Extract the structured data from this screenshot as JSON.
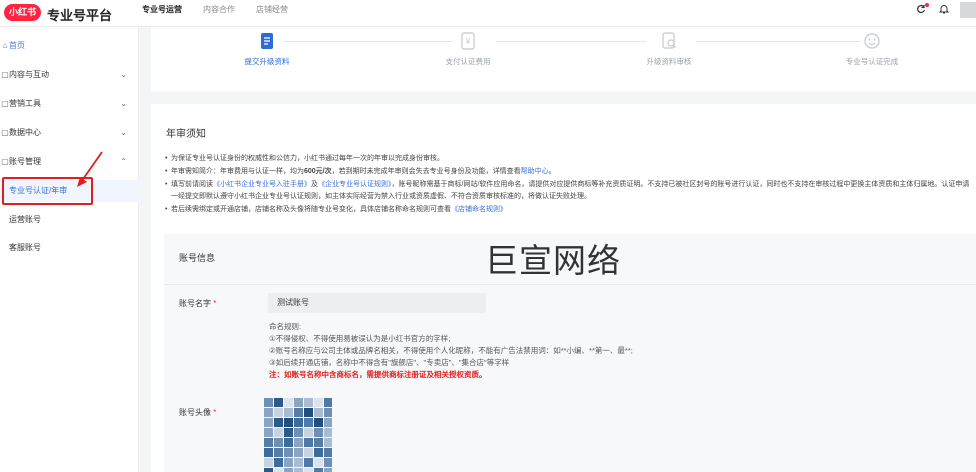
{
  "brand": {
    "logo_text": "小红书",
    "platform": "专业号平台"
  },
  "topnav": [
    {
      "label": "专业号运营"
    },
    {
      "label": "内容合作"
    },
    {
      "label": "店铺经营"
    }
  ],
  "sidebar": {
    "items": [
      {
        "label": "首页",
        "icon": "home-icon"
      },
      {
        "label": "内容与互动",
        "icon": "content-icon"
      },
      {
        "label": "营销工具",
        "icon": "marketing-icon"
      },
      {
        "label": "数据中心",
        "icon": "data-icon"
      },
      {
        "label": "账号管理",
        "icon": "account-icon"
      }
    ],
    "sub_items": [
      {
        "label": "专业号认证/年审"
      },
      {
        "label": "运营账号"
      },
      {
        "label": "客服账号"
      }
    ]
  },
  "steps": [
    {
      "label": "提交升级资料",
      "icon": "document-icon"
    },
    {
      "label": "支付认证费用",
      "icon": "payment-icon"
    },
    {
      "label": "升级资料审核",
      "icon": "review-icon"
    },
    {
      "label": "专业号认证完成",
      "icon": "smile-icon"
    }
  ],
  "annual_review": {
    "title": "年审须知",
    "p1": "为保证专业号认证身份的权威性和公信力，小红书通过每年一次的年审以完成身份审核。",
    "p2_a": "年审需知简介：年审费用与认证一样，均为",
    "p2_price": "600元/次",
    "p2_b": "，若到期时未完成年审则会失去专业号身份及功能，详情查看",
    "p2_link": "帮助中心",
    "p2_end": "。",
    "p3_a": "填写前请阅读",
    "p3_link1": "《小红书企业专业号入驻手册》",
    "p3_and": "及",
    "p3_link2": "《企业专业号认证规则》",
    "p3_b": "，账号昵称需基于商标/网站/软件应用命名，请提供对应提供商标等补充资质证明。不支持已被社区封号的账号进行认证，同时也不支持在审核过程中更换主体资质和主体归属地。认证申请一经提交即默认遵守小红书企业专业号认证规则，如主体实际经营为禁入行业或资质虚假、不符合资质审核标准的，将做认证失败处理。",
    "p4_a": "若后续需绑定或开通店铺，店铺名称及头像将随专业号变化，具体店铺名称命名规则可查看",
    "p4_link": "《店铺命名规则》"
  },
  "account_info": {
    "title": "账号信息",
    "watermark": "巨宣网络",
    "name_label": "账号名字",
    "required_mark": "*",
    "name_value": "测试账号",
    "rules": [
      "命名规则:",
      "①不得侵权、不得使用易被误认为是小红书官方的字样;",
      "②账号名称应与公司主体或品牌名相关，不得使用个人化昵称，不能有广告法禁用词：如**小编、**第一、最**;",
      "③如后续开通店铺，名称中不得含有\"旗舰店\"、\"专卖店\"、\"集合店\"等字样"
    ],
    "warning": "注：如账号名称中含商标名，需提供商标注册证及相关授权资质。",
    "avatar_label": "账号头像"
  },
  "colors": {
    "brand_red": "#ff2442",
    "accent_blue": "#2b6cd8",
    "annotation_red": "#e21d1d"
  }
}
